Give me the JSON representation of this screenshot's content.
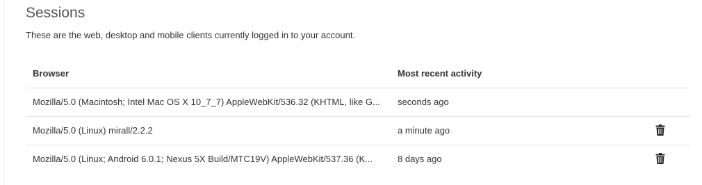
{
  "sessions": {
    "title": "Sessions",
    "description": "These are the web, desktop and mobile clients currently logged in to your account.",
    "columns": {
      "browser": "Browser",
      "activity": "Most recent activity"
    },
    "rows": [
      {
        "browser": "Mozilla/5.0 (Macintosh; Intel Mac OS X 10_7_7) AppleWebKit/536.32 (KHTML, like G...",
        "activity": "seconds ago",
        "revocable": false
      },
      {
        "browser": "Mozilla/5.0 (Linux) mirall/2.2.2",
        "activity": "a minute ago",
        "revocable": true,
        "action_icon": "trash-icon"
      },
      {
        "browser": "Mozilla/5.0 (Linux; Android 6.0.1; Nexus 5X Build/MTC19V) AppleWebKit/537.36 (K...",
        "activity": "8 days ago",
        "revocable": true,
        "action_icon": "trash-icon"
      }
    ]
  }
}
